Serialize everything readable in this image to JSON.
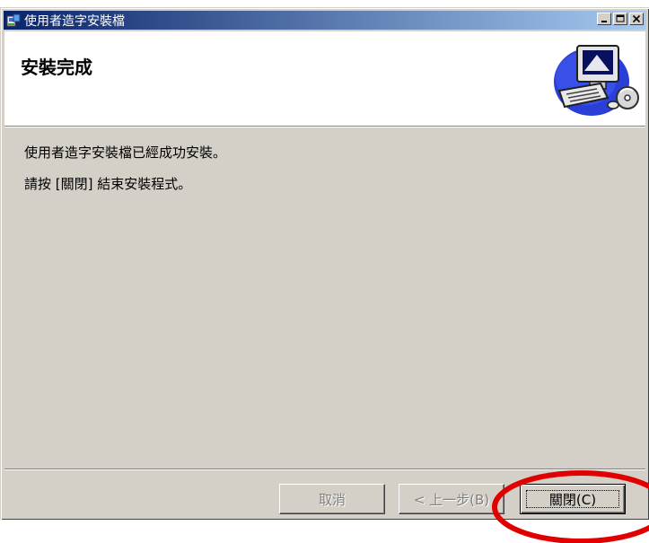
{
  "window": {
    "title": "使用者造字安裝檔",
    "controls": [
      "minimize",
      "maximize",
      "close"
    ]
  },
  "banner": {
    "title": "安裝完成",
    "art_icon": "computer-setup-icon"
  },
  "body": {
    "line1": "使用者造字安裝檔已經成功安裝。",
    "line2": "請按 [關閉] 結束安裝程式。"
  },
  "buttons": {
    "cancel": "取消",
    "back": "< 上一步(B)",
    "close": "關閉(C)"
  },
  "colors": {
    "dialog_bg": "#d4d0c8",
    "titlebar_start": "#0a246a",
    "titlebar_end": "#a6caf0",
    "highlight_circle": "#e00000"
  }
}
